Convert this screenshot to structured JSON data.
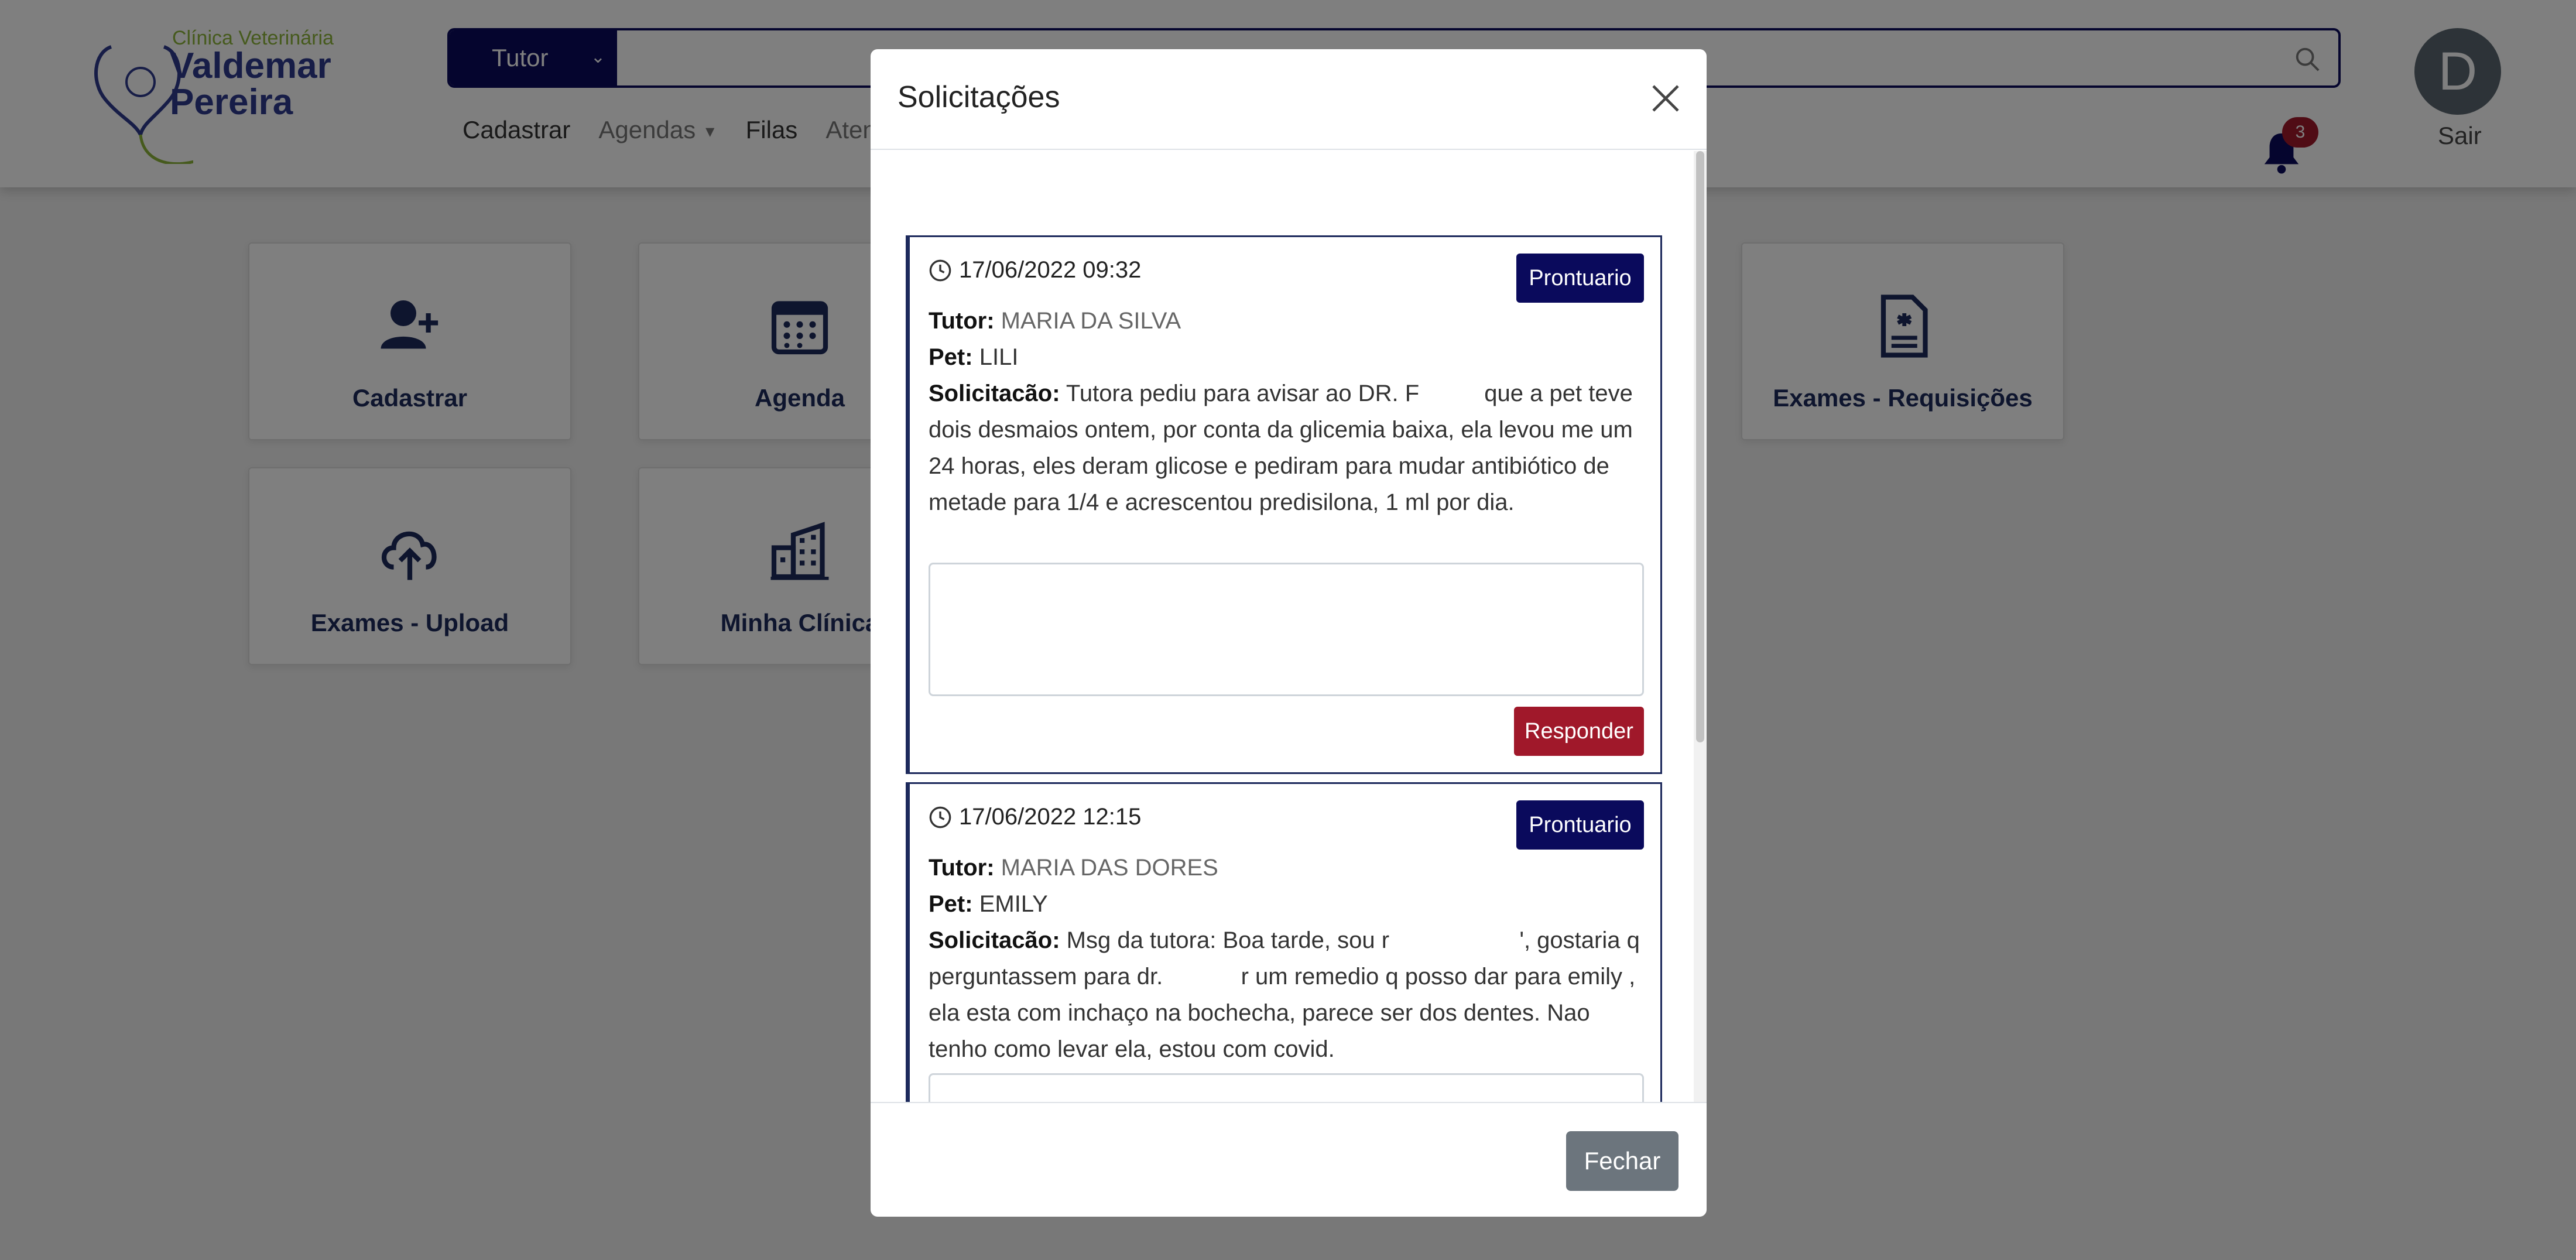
{
  "logo": {
    "small": "Clínica Veterinária",
    "big": "Valdemar\nPereira"
  },
  "search": {
    "select_value": "Tutor",
    "placeholder": ""
  },
  "nav": {
    "cadastrar": "Cadastrar",
    "agendas": "Agendas",
    "filas": "Filas",
    "atend": "Atend"
  },
  "notifications": {
    "count": "3"
  },
  "user": {
    "initial": "D",
    "logout": "Sair"
  },
  "cards": [
    {
      "label": "Cadastrar",
      "icon": "user-plus-icon"
    },
    {
      "label": "Agenda",
      "icon": "calendar-icon"
    },
    {
      "label": "Exames - Requisições",
      "icon": "file-medical-icon"
    },
    {
      "label": "Exames - Upload",
      "icon": "cloud-upload-icon"
    },
    {
      "label": "Minha Clínica",
      "icon": "building-icon"
    }
  ],
  "modal": {
    "title": "Solicitações",
    "close_label": "Fechar",
    "prontuario_label": "Prontuario",
    "responder_label": "Responder",
    "tutor_label": "Tutor:",
    "pet_label": "Pet:",
    "solicitacao_label": "Solicitacão:",
    "requests": [
      {
        "datetime": "17/06/2022 09:32",
        "tutor": "MARIA DA SILVA",
        "pet": "LILI",
        "text": "Tutora pediu para avisar ao DR. F          que a pet teve dois desmaios ontem, por conta da glicemia baixa, ela levou me um 24 horas, eles deram glicose e pediram para mudar antibiótico de metade para 1/4 e acrescentou predisilona, 1 ml por dia."
      },
      {
        "datetime": "17/06/2022 12:15",
        "tutor": "MARIA DAS DORES",
        "pet": "EMILY",
        "text": "Msg da tutora: Boa tarde, sou r                    ', gostaria q perguntassem para dr.            r um remedio q posso dar para emily , ela esta com inchaço na bochecha, parece ser dos dentes. Nao tenho como levar ela, estou com covid."
      }
    ]
  }
}
